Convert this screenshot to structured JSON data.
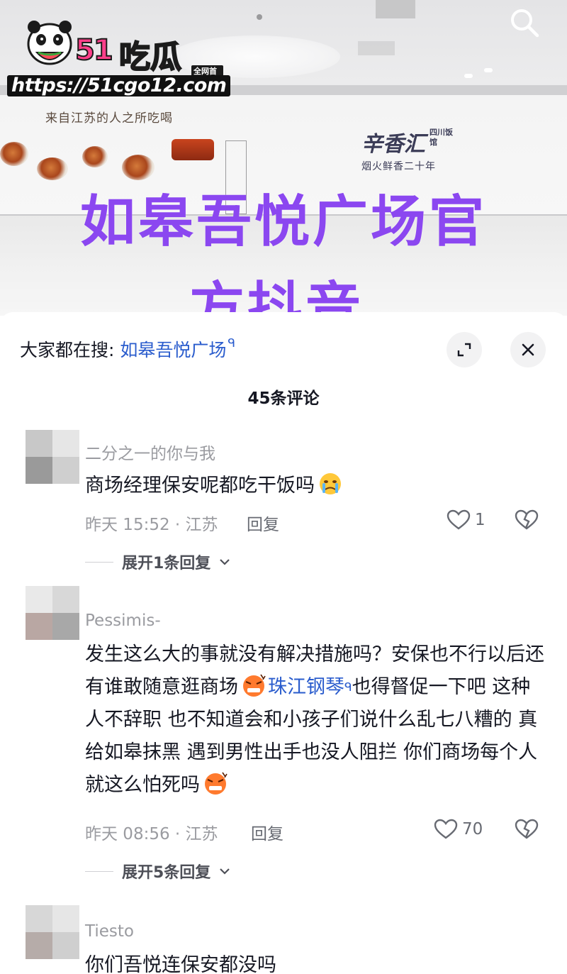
{
  "watermark": {
    "brand_51": "51",
    "brand_chigua": "吃瓜",
    "badge": "全网首发",
    "url": "https://51cgo12.com"
  },
  "video": {
    "wall_caption": "来自江苏的人之所吃喝",
    "restaurant_name": "辛香汇",
    "restaurant_side": "四川饭馆",
    "restaurant_slogan": "烟火鲜香二十年",
    "overlay_line1": "如皋吾悦广场官",
    "overlay_line2": "方抖音",
    "search_icon": "search-icon"
  },
  "sheet": {
    "trending_label": "大家都在搜: ",
    "trending_keyword": "如皋吾悦广场",
    "trending_search_mark": "ᑫ",
    "comment_count": "45条评论"
  },
  "comments": [
    {
      "user": "二分之一的你与我",
      "text": "商场经理保安呢都吃干饭吗",
      "emoji": "crying-face",
      "meta": "昨天 15:52 · 江苏",
      "reply": "回复",
      "likes": "1",
      "expand": "展开1条回复"
    },
    {
      "user": "Pessimis-",
      "text_part1": "发生这么大的事就没有解决措施吗？安保也不行以后还有谁敢随意逛商场",
      "emoji": "angry-face",
      "keyword": "珠江钢琴",
      "search_mark": "ᑫ",
      "text_part2": "也得督促一下吧 这种人不辞职 也不知道会和小孩子们说什么乱七八糟的 真给如皋抹黑 遇到男性出手也没人阻拦 你们商场每个人就这么怕死吗",
      "meta": "昨天 08:56 · 江苏",
      "reply": "回复",
      "likes": "70",
      "expand": "展开5条回复"
    },
    {
      "user": "Tiesto",
      "text": "你们吾悦连保安都没吗"
    }
  ],
  "colors": {
    "overlay_purple": "#8b47f0",
    "link_blue": "#2a5ccd",
    "muted_gray": "#9a9ba0"
  }
}
